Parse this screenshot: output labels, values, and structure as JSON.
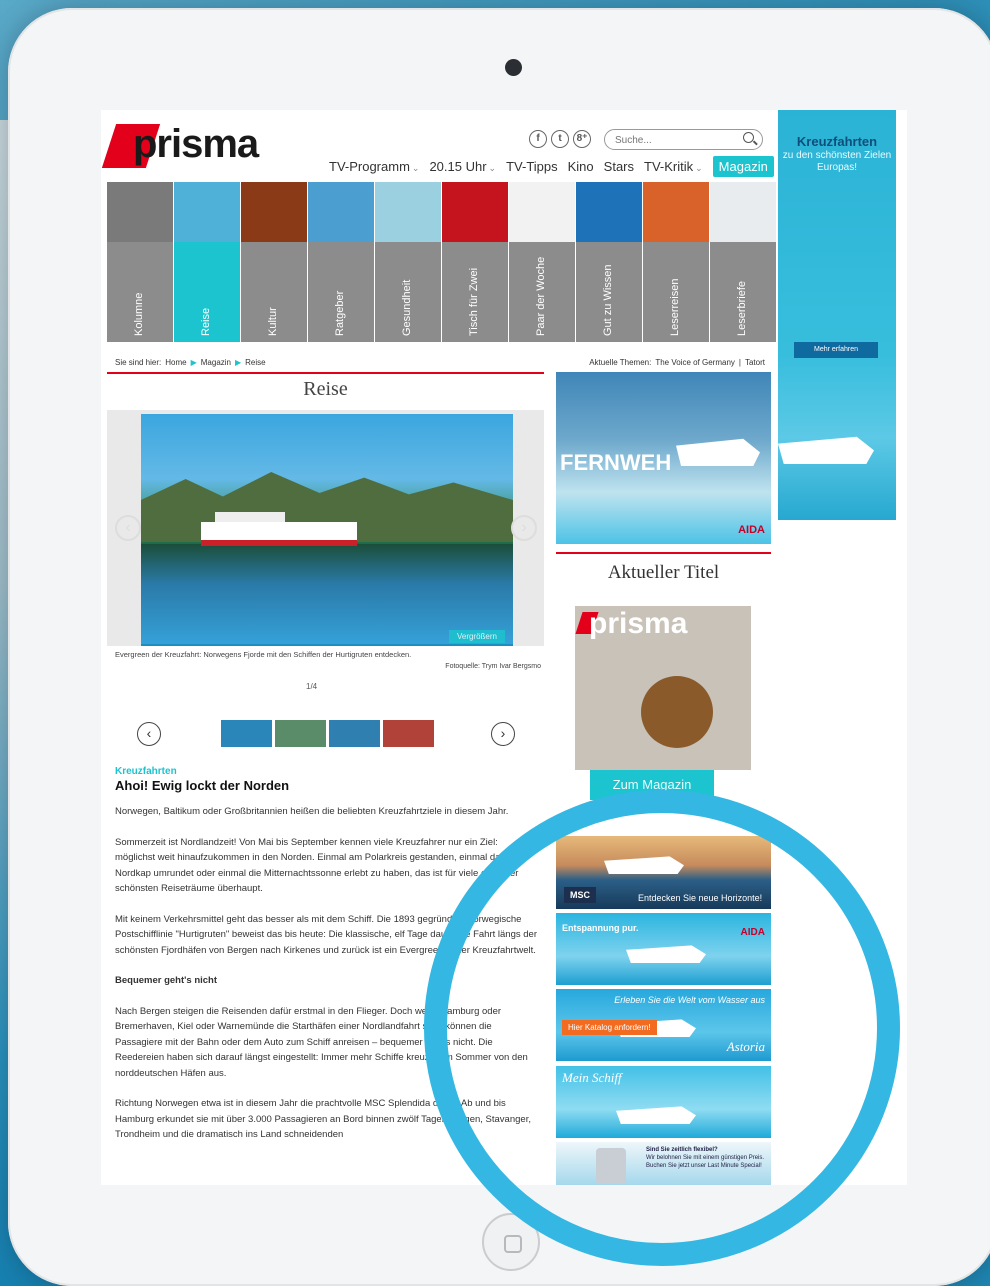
{
  "logo": {
    "text": "prisma"
  },
  "social": [
    {
      "icon": "facebook-icon",
      "glyph": "f"
    },
    {
      "icon": "twitter-icon",
      "glyph": "t"
    },
    {
      "icon": "googleplus-icon",
      "glyph": "8⁺"
    }
  ],
  "search": {
    "placeholder": "Suche..."
  },
  "topnav": [
    {
      "label": "TV-Programm",
      "dropdown": true
    },
    {
      "label": "20.15 Uhr",
      "dropdown": true
    },
    {
      "label": "TV-Tipps",
      "dropdown": false
    },
    {
      "label": "Kino",
      "dropdown": false
    },
    {
      "label": "Stars",
      "dropdown": false
    },
    {
      "label": "TV-Kritik",
      "dropdown": true
    },
    {
      "label": "Magazin",
      "dropdown": false,
      "active": true
    }
  ],
  "tiles": [
    {
      "label": "Kolumne",
      "color": "#7a7a7a"
    },
    {
      "label": "Reise",
      "color": "#4fb0d8",
      "active": true
    },
    {
      "label": "Kultur",
      "color": "#8a3a16"
    },
    {
      "label": "Ratgeber",
      "color": "#4a9fd0"
    },
    {
      "label": "Gesundheit",
      "color": "#9bd0e0"
    },
    {
      "label": "Tisch für Zwei",
      "color": "#c6141e"
    },
    {
      "label": "Paar der Woche",
      "color": "#f2f2f2"
    },
    {
      "label": "Gut zu Wissen",
      "color": "#1e73b8"
    },
    {
      "label": "Leserreisen",
      "color": "#d9622a"
    },
    {
      "label": "Leserbriefe",
      "color": "#e9ecef"
    }
  ],
  "breadcrumb": {
    "prefix": "Sie sind hier:",
    "items": [
      "Home",
      "Magazin",
      "Reise"
    ]
  },
  "themes": {
    "prefix": "Aktuelle Themen:",
    "items": [
      "The Voice of Germany",
      "|",
      "Tatort"
    ]
  },
  "section_title": "Reise",
  "slider": {
    "zoom_label": "Vergrößern",
    "caption": "Evergreen der Kreuzfahrt: Norwegens Fjorde mit den Schiffen der Hurtigruten entdecken.",
    "credit": "Fotoquelle: Trym Ivar Bergsmo",
    "counter": "1/4",
    "prev_glyph": "‹",
    "next_glyph": "›"
  },
  "thumbs": [
    {
      "color": "#2a86b8"
    },
    {
      "color": "#5a8c6a"
    },
    {
      "color": "#2f7fb0"
    },
    {
      "color": "#b0423a"
    }
  ],
  "article": {
    "kicker": "Kreuzfahrten",
    "headline": "Ahoi! Ewig lockt der Norden",
    "p1": "Norwegen, Baltikum oder Großbritannien heißen die beliebten Kreuzfahrtziele in diesem Jahr.",
    "p2": "Sommerzeit ist Nordlandzeit! Von Mai bis September kennen viele Kreuzfahrer nur ein Ziel: möglichst weit hinaufzukommen in den Norden. Einmal am Polarkreis gestanden, einmal das Nordkap umrundet oder einmal die Mitternachtssonne erlebt zu haben, das ist für viele einer der schönsten Reiseträume überhaupt.",
    "p3": "Mit keinem Verkehrsmittel geht das besser als mit dem Schiff. Die 1893 gegründete norwegische Postschifflinie \"Hurtigruten\" beweist das bis heute: Die klassische, elf Tage dauernde Fahrt längs der schönsten Fjordhäfen von Bergen nach Kirkenes und zurück ist ein Evergreen in der Kreuzfahrtwelt.",
    "subhead": "Bequemer geht's nicht",
    "p4": "Nach Bergen steigen die Reisenden dafür erstmal in den Flieger. Doch wenn Hamburg oder Bremerhaven, Kiel oder Warnemünde die Starthäfen einer Nordlandfahrt sind, können die Passagiere mit der Bahn oder dem Auto zum Schiff anreisen – bequemer geht's nicht. Die Reedereien haben sich darauf längst eingestellt: Immer mehr Schiffe kreuzen im Sommer von den norddeutschen Häfen aus.",
    "p5": "Richtung Norwegen etwa ist in diesem Jahr die prachtvolle MSC Splendida dabei: Ab und bis Hamburg erkundet sie mit über 3.000 Passagieren an Bord binnen zwölf Tagen Bergen, Stavanger, Trondheim und die dramatisch ins Land schneidenden"
  },
  "fernweh_ad": {
    "title": "FERNWEH",
    "brand": "AIDA"
  },
  "aktueller_titel": {
    "title": "Aktueller Titel",
    "cover_logo": "prisma",
    "button": "Zum Magazin"
  },
  "ads": {
    "msc": {
      "brand": "MSC",
      "text": "Entdecken Sie neue Horizonte!"
    },
    "aida": {
      "text": "Entspannung pur.",
      "brand": "AIDA"
    },
    "astoria": {
      "text": "Erleben Sie die Welt vom Wasser aus",
      "button": "Hier Katalog anfordern!",
      "brand": "Astoria"
    },
    "meinschiff": {
      "text": "Mein Schiff"
    },
    "lastminute": {
      "title": "Sind Sie zeitlich flexibel?",
      "text": "Wir belohnen Sie mit einem günstigen Preis. Buchen Sie jetzt unser Last Minute Special!"
    }
  },
  "sky_ad": {
    "title": "Kreuzfahrten",
    "subtitle": "zu den schönsten Zielen Europas!",
    "button": "Mehr erfahren"
  },
  "colors": {
    "accent": "#1cc4cf",
    "brand_red": "#e2001a",
    "highlight_ring": "#34b7e2"
  }
}
